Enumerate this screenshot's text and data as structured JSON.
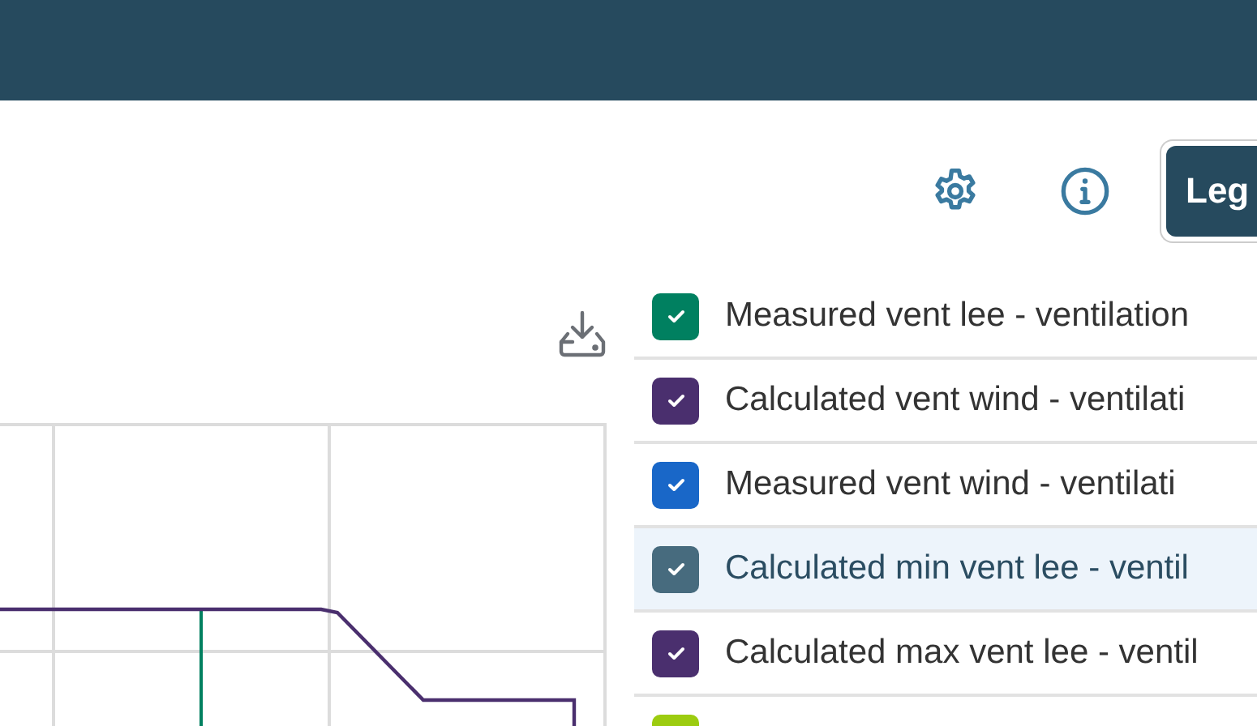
{
  "toolbar": {
    "legend_button": {
      "label": "Leg"
    }
  },
  "legend": {
    "items": [
      {
        "label": "Measured vent lee - ventilation",
        "color": "#008060",
        "checked": true,
        "selected": false
      },
      {
        "label": "Calculated vent wind - ventilati",
        "color": "#4a2f6e",
        "checked": true,
        "selected": false
      },
      {
        "label": "Measured vent wind - ventilati",
        "color": "#1967c8",
        "checked": true,
        "selected": false
      },
      {
        "label": "Calculated min vent lee - ventil",
        "color": "#476b7e",
        "checked": true,
        "selected": true
      },
      {
        "label": "Calculated max vent lee - ventil",
        "color": "#4a2f6e",
        "checked": true,
        "selected": false
      },
      {
        "color": "#9ccc10",
        "selected": false
      }
    ]
  }
}
